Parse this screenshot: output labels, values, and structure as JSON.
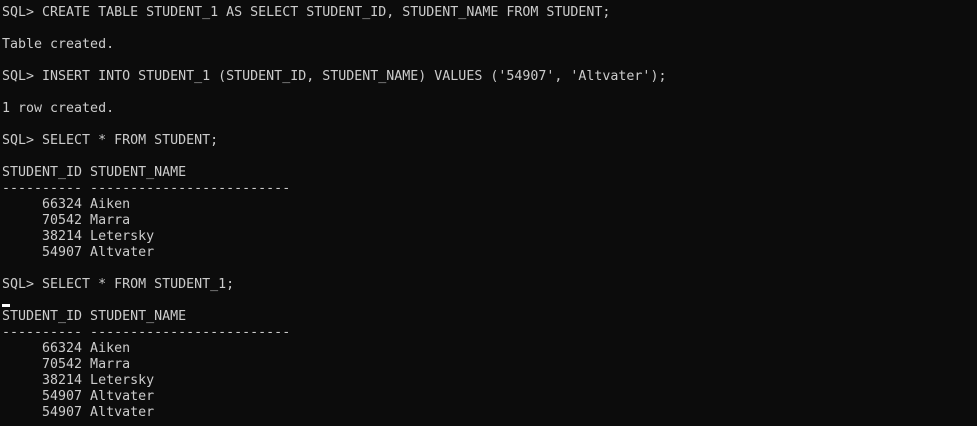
{
  "terminal": {
    "colors": {
      "background": "#0c0c0c",
      "text": "#cccccc",
      "cursor": "#ffffff"
    },
    "lines": [
      "SQL> CREATE TABLE STUDENT_1 AS SELECT STUDENT_ID, STUDENT_NAME FROM STUDENT;",
      "",
      "Table created.",
      "",
      "SQL> INSERT INTO STUDENT_1 (STUDENT_ID, STUDENT_NAME) VALUES ('54907', 'Altvater');",
      "",
      "1 row created.",
      "",
      "SQL> SELECT * FROM STUDENT;",
      "",
      "STUDENT_ID STUDENT_NAME",
      "---------- -------------------------",
      "     66324 Aiken",
      "     70542 Marra",
      "     38214 Letersky",
      "     54907 Altvater",
      "",
      "SQL> SELECT * FROM STUDENT_1;",
      "",
      "STUDENT_ID STUDENT_NAME",
      "---------- -------------------------",
      "     66324 Aiken",
      "     70542 Marra",
      "     38214 Letersky",
      "     54907 Altvater",
      "     54907 Altvater"
    ]
  }
}
